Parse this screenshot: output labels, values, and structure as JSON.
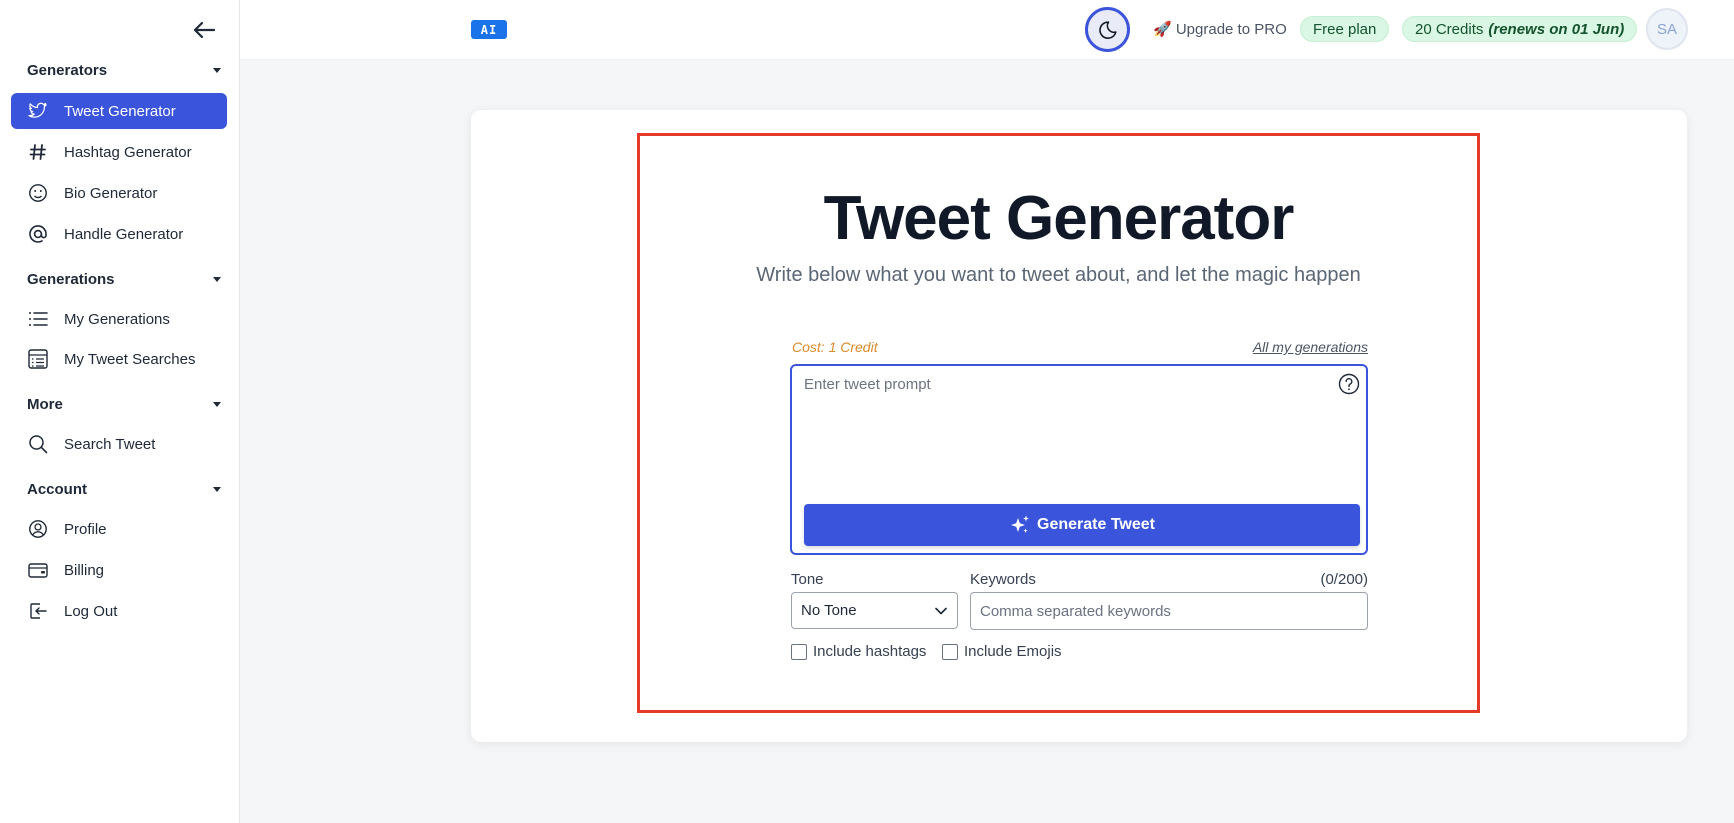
{
  "sidebar": {
    "sections": [
      {
        "title": "Generators",
        "items": [
          {
            "label": "Tweet Generator",
            "icon": "twitter-bird-icon",
            "active": true
          },
          {
            "label": "Hashtag Generator",
            "icon": "hashtag-icon"
          },
          {
            "label": "Bio Generator",
            "icon": "face-icon"
          },
          {
            "label": "Handle Generator",
            "icon": "at-sign-icon"
          }
        ]
      },
      {
        "title": "Generations",
        "items": [
          {
            "label": "My Generations",
            "icon": "list-icon"
          },
          {
            "label": "My Tweet Searches",
            "icon": "table-list-icon"
          }
        ]
      },
      {
        "title": "More",
        "items": [
          {
            "label": "Search Tweet",
            "icon": "search-icon"
          }
        ]
      },
      {
        "title": "Account",
        "items": [
          {
            "label": "Profile",
            "icon": "user-circle-icon"
          },
          {
            "label": "Billing",
            "icon": "wallet-icon"
          },
          {
            "label": "Log Out",
            "icon": "logout-icon"
          }
        ]
      }
    ]
  },
  "topbar": {
    "ai_badge": "AI",
    "upgrade_label": "🚀 Upgrade to PRO",
    "plan_label": "Free plan",
    "credits_label": "20 Credits",
    "credits_renew": "(renews on 01 Jun)",
    "avatar_initials": "SA"
  },
  "main": {
    "title": "Tweet Generator",
    "subtitle": "Write below what you want to tweet about, and let the magic happen",
    "cost_label": "Cost: 1 Credit",
    "all_generations_link": "All my generations",
    "prompt_placeholder": "Enter tweet prompt",
    "generate_button": "Generate Tweet",
    "tone_label": "Tone",
    "tone_value": "No Tone",
    "keywords_label": "Keywords",
    "keywords_count": "(0/200)",
    "keywords_placeholder": "Comma separated keywords",
    "include_hashtags": "Include hashtags",
    "include_emojis": "Include Emojis"
  },
  "colors": {
    "accent": "#3b54dc",
    "highlight_border": "#e53a2a",
    "pill_bg": "#d9f7e4",
    "cost_text": "#d98a2b"
  }
}
